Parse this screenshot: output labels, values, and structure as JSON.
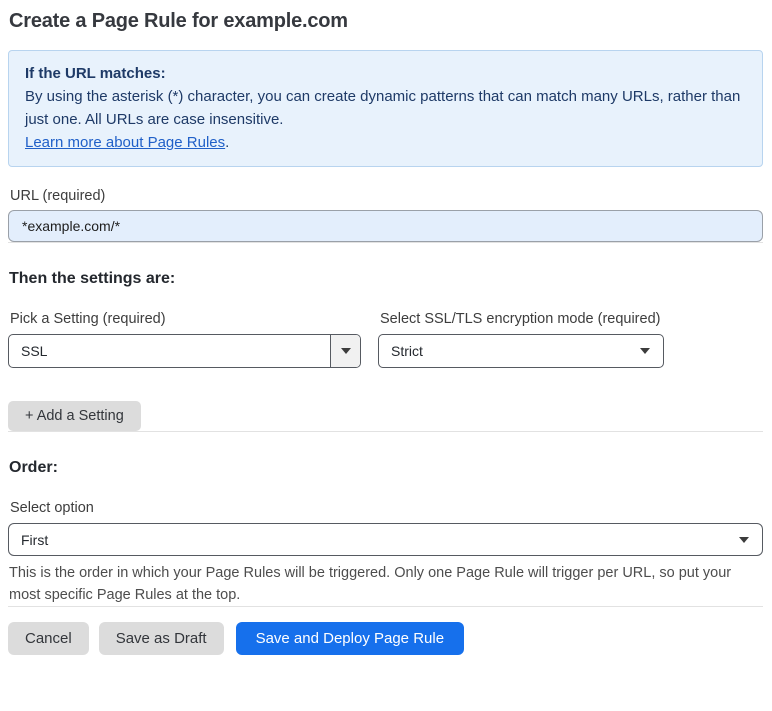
{
  "page": {
    "title": "Create a Page Rule for example.com"
  },
  "info_box": {
    "heading": "If the URL matches:",
    "body": "By using the asterisk (*) character, you can create dynamic patterns that can match many URLs, rather than just one. All URLs are case insensitive.",
    "link_label": "Learn more about Page Rules",
    "link_suffix": "."
  },
  "url_field": {
    "label": "URL (required)",
    "value": "*example.com/*"
  },
  "settings_section": {
    "heading": "Then the settings are:",
    "setting_picker": {
      "label": "Pick a Setting (required)",
      "value": "SSL"
    },
    "ssl_mode_picker": {
      "label": "Select SSL/TLS encryption mode (required)",
      "value": "Strict"
    },
    "add_setting_label": "+ Add a Setting"
  },
  "order_section": {
    "heading": "Order:",
    "select_label": "Select option",
    "value": "First",
    "help_text": "This is the order in which your Page Rules will be triggered. Only one Page Rule will trigger per URL, so put your most specific Page Rules at the top."
  },
  "footer": {
    "cancel_label": "Cancel",
    "save_draft_label": "Save as Draft",
    "save_deploy_label": "Save and Deploy Page Rule"
  },
  "colors": {
    "accent_blue": "#1670ec",
    "info_bg": "#e8f2fc",
    "info_border": "#b8d4ef",
    "info_text": "#1e3a67",
    "link_blue": "#2060c8",
    "input_bg": "#e3eefc"
  }
}
